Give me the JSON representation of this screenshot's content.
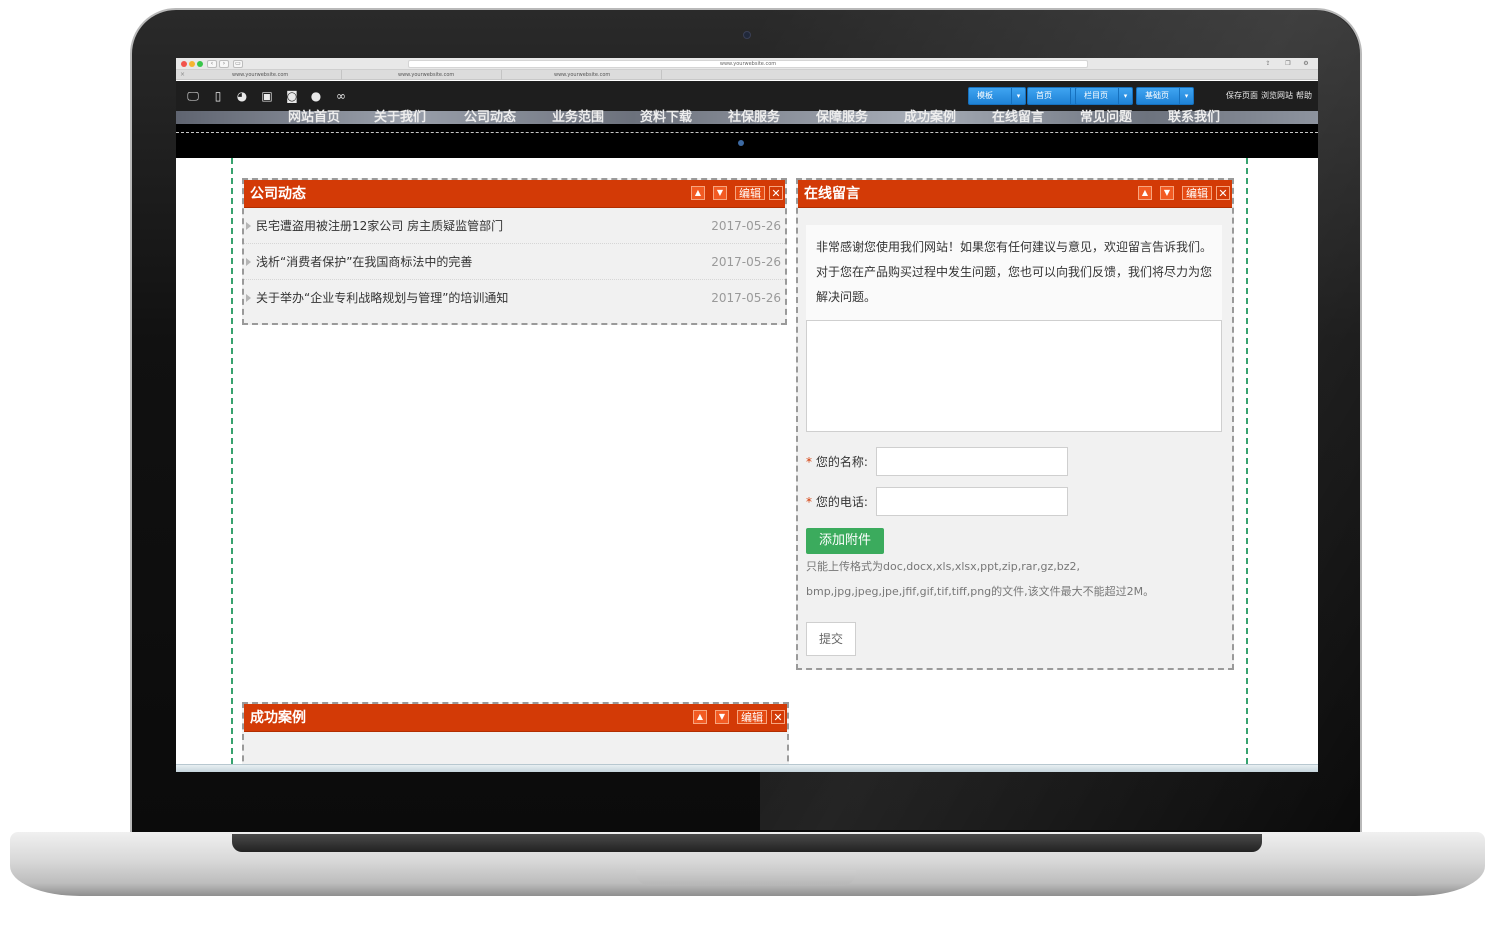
{
  "browser": {
    "url": "www.yourwebsite.com",
    "tabs": [
      "www.yourwebsite.com",
      "www.yourwebsite.com",
      "www.yourwebsite.com"
    ]
  },
  "editor_toolbar": {
    "device_icons": [
      "desktop-icon",
      "mobile-icon",
      "wechat-icon",
      "mini-program-icon",
      "android-icon",
      "apple-icon",
      "link-icon"
    ],
    "buttons": [
      "模板",
      "首页",
      "栏目页",
      "基础页"
    ],
    "links": {
      "save": "保存页面",
      "preview": "浏览网站",
      "help": "帮助"
    }
  },
  "banner": {
    "menu": [
      "网站首页",
      "关于我们",
      "公司动态",
      "业务范围",
      "资料下载",
      "社保服务",
      "保障服务",
      "成功案例",
      "在线留言",
      "常见问题",
      "联系我们"
    ]
  },
  "news_module": {
    "title": "公司动态",
    "edit_label": "编辑",
    "items": [
      {
        "title": "民宅遭盗用被注册12家公司 房主质疑监管部门",
        "date": "2017-05-26"
      },
      {
        "title": "浅析“消费者保护”在我国商标法中的完善",
        "date": "2017-05-26"
      },
      {
        "title": "关于举办“企业专利战略规划与管理”的培训通知",
        "date": "2017-05-26"
      }
    ]
  },
  "message_module": {
    "title": "在线留言",
    "edit_label": "编辑",
    "intro": "非常感谢您使用我们网站！如果您有任何建议与意见，欢迎留言告诉我们。对于您在产品购买过程中发生问题，您也可以向我们反馈，我们将尽力为您解决问题。",
    "name_label": "您的名称:",
    "phone_label": "您的电话:",
    "required_mark": "*",
    "attach_button": "添加附件",
    "hint_line1": "只能上传格式为doc,docx,xls,xlsx,ppt,zip,rar,gz,bz2,",
    "hint_line2": "bmp,jpg,jpeg,jpe,jfif,gif,tif,tiff,png的文件,该文件最大不能超过2M。",
    "submit_button": "提交"
  },
  "cases_module": {
    "title": "成功案例",
    "edit_label": "编辑"
  },
  "colors": {
    "module_header": "#d33a06",
    "zone_border": "#37a36f",
    "toolbar_button": "#2b93e6",
    "attach_button": "#3bab5d"
  }
}
